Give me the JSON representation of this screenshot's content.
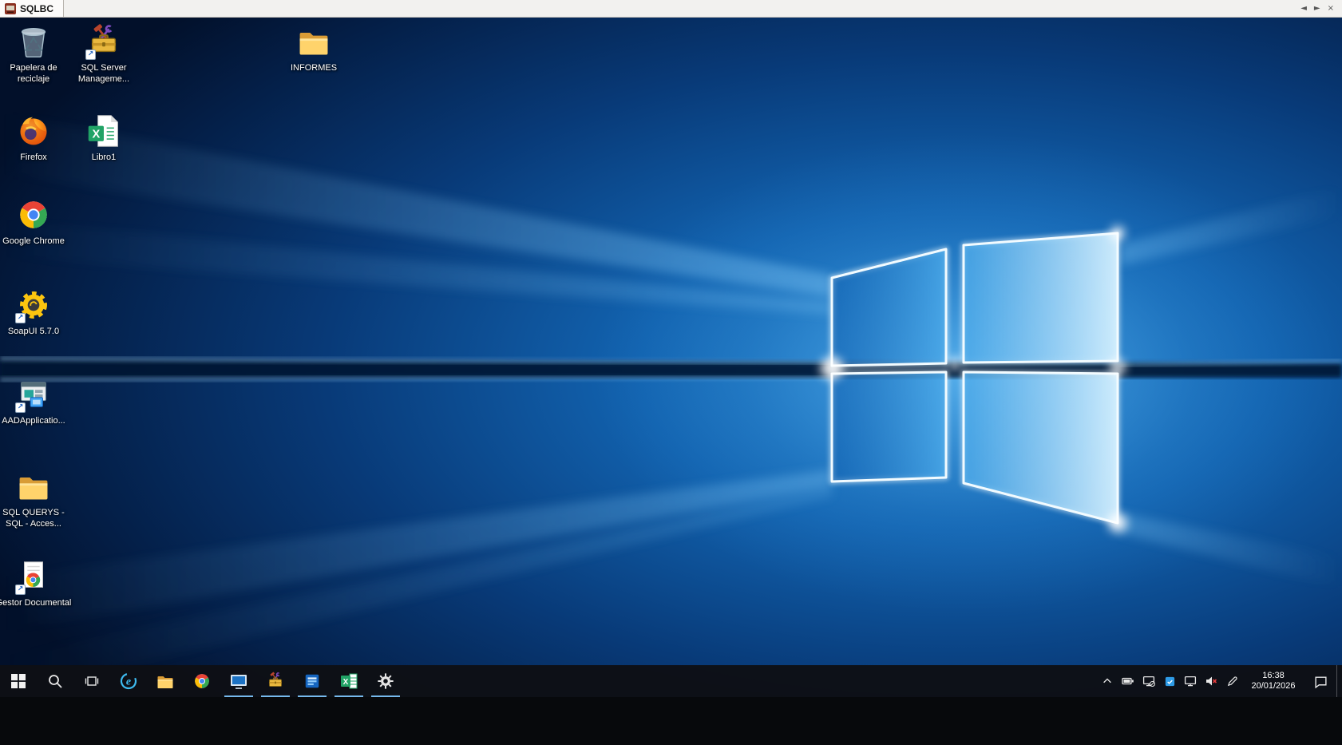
{
  "app_window": {
    "tab_title": "SQLBC",
    "controls": {
      "prev": "◄",
      "next": "►",
      "close": "×"
    }
  },
  "desktop": {
    "wallpaper": "windows-10-hero",
    "icons": [
      {
        "name": "papelera-de-reciclaje",
        "label": "Papelera de reciclaje"
      },
      {
        "name": "sql-server-management-studio",
        "label": "SQL Server Manageme...",
        "shortcut": true
      },
      {
        "name": "informes-folder",
        "label": "INFORMES"
      },
      {
        "name": "firefox",
        "label": "Firefox"
      },
      {
        "name": "libro1-excel-workbook",
        "label": "Libro1"
      },
      {
        "name": "google-chrome",
        "label": "Google Chrome"
      },
      {
        "name": "soapui",
        "label": "SoapUI 5.7.0",
        "shortcut": true
      },
      {
        "name": "aadapplication",
        "label": "AADApplicatio...",
        "shortcut": true
      },
      {
        "name": "sql-querys-folder",
        "label": "SQL QUERYS - SQL - Acces..."
      },
      {
        "name": "gestor-documental",
        "label": "Gestor Documental",
        "shortcut": true
      }
    ]
  },
  "taskbar": {
    "accent_color": "#76b9ed",
    "buttons": [
      {
        "name": "start",
        "running": false
      },
      {
        "name": "search",
        "running": false
      },
      {
        "name": "task-view",
        "running": false
      },
      {
        "name": "internet-explorer",
        "running": false
      },
      {
        "name": "file-explorer",
        "running": false
      },
      {
        "name": "google-chrome",
        "running": false
      },
      {
        "name": "remote-desktop-window",
        "running": true
      },
      {
        "name": "sql-server-management-studio",
        "running": true
      },
      {
        "name": "blue-app",
        "running": true
      },
      {
        "name": "excel",
        "running": true
      },
      {
        "name": "settings",
        "running": true
      }
    ],
    "tray": {
      "icons": [
        "hidden-icons-chevron",
        "battery",
        "network-disconnected",
        "app-indicator",
        "display",
        "volume-muted",
        "pen"
      ],
      "time": "16:38",
      "date": "20/01/2026"
    }
  }
}
